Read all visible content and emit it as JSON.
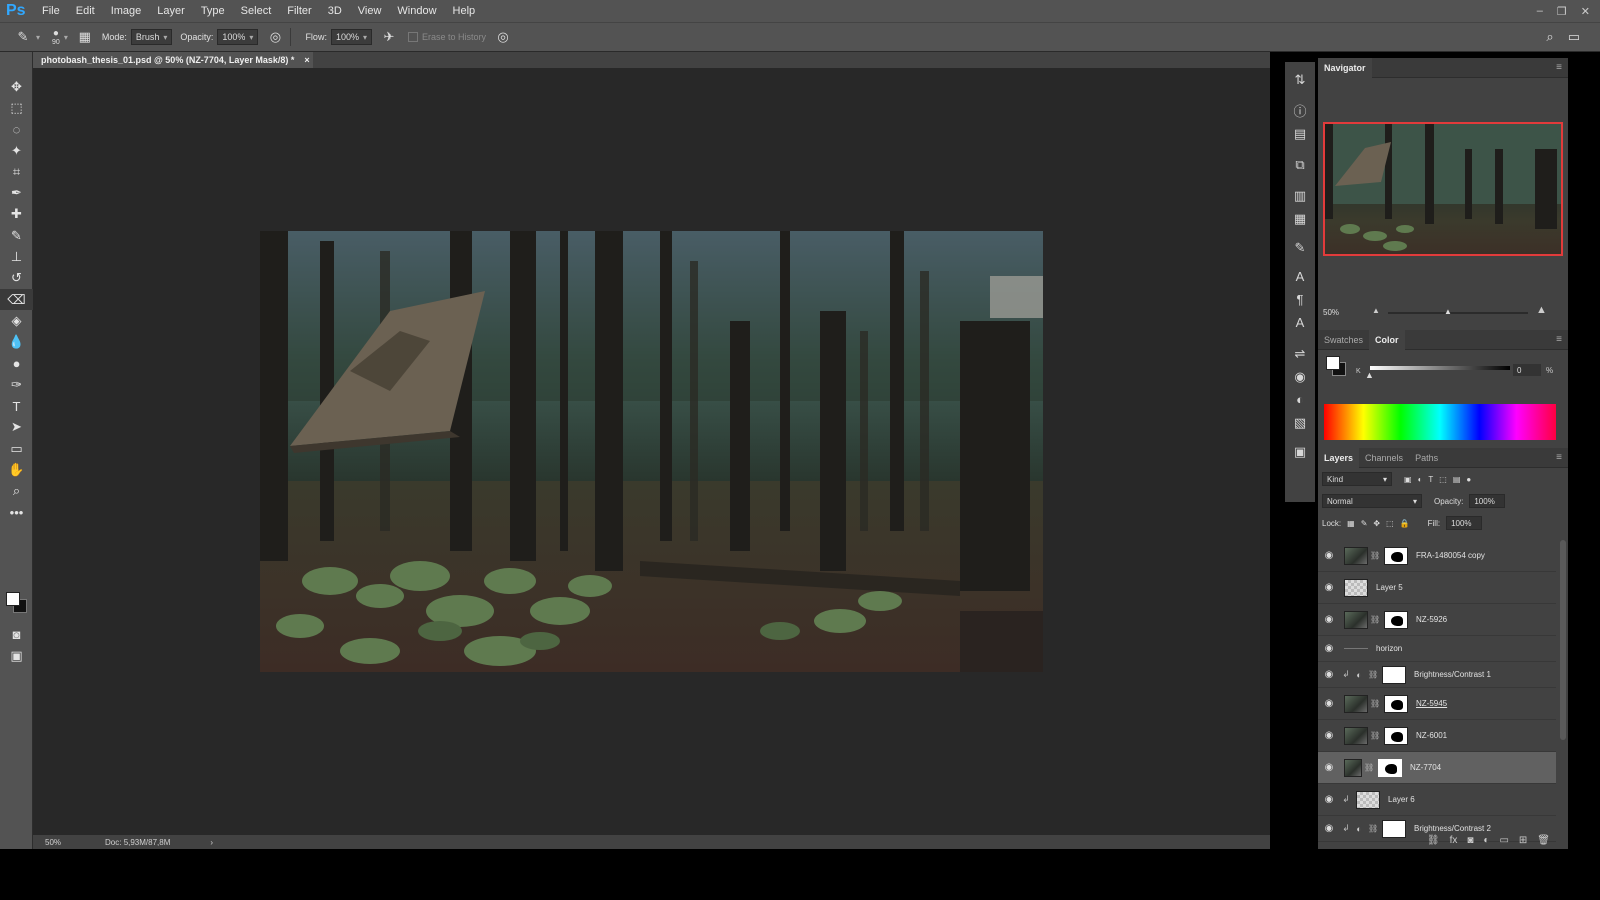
{
  "app": {
    "logo": "Ps"
  },
  "menu": [
    "File",
    "Edit",
    "Image",
    "Layer",
    "Type",
    "Select",
    "Filter",
    "3D",
    "View",
    "Window",
    "Help"
  ],
  "options_bar": {
    "brush_size": "90",
    "mode_label": "Mode:",
    "mode_value": "Brush",
    "opacity_label": "Opacity:",
    "opacity_value": "100%",
    "flow_label": "Flow:",
    "flow_value": "100%",
    "erase_history_label": "Erase to History"
  },
  "document": {
    "tab_title": "photobash_thesis_01.psd @ 50% (NZ-7704, Layer Mask/8) *",
    "close": "×"
  },
  "status": {
    "zoom": "50%",
    "doc_info": "Doc: 5,93M/87,8M",
    "arrow": "›"
  },
  "navigator": {
    "title": "Navigator",
    "zoom": "50%"
  },
  "color_panel": {
    "tabs": [
      "Swatches",
      "Color"
    ],
    "active_tab": "Color",
    "channel_label": "K",
    "k_value": "0",
    "percent": "%"
  },
  "layers_panel": {
    "tabs": [
      "Layers",
      "Channels",
      "Paths"
    ],
    "active_tab": "Layers",
    "kind_filter": "Kind",
    "blend_mode": "Normal",
    "opacity_label": "Opacity:",
    "opacity_value": "100%",
    "lock_label": "Lock:",
    "fill_label": "Fill:",
    "fill_value": "100%",
    "layers": [
      {
        "name": "FRA-1480054 copy",
        "type": "image-mask",
        "selected": false,
        "underline": false
      },
      {
        "name": "Layer 5",
        "type": "transparent",
        "selected": false,
        "underline": false
      },
      {
        "name": "NZ-5926",
        "type": "image-mask",
        "selected": false,
        "underline": false
      },
      {
        "name": "horizon",
        "type": "line",
        "selected": false,
        "underline": false
      },
      {
        "name": "Brightness/Contrast 1",
        "type": "adjustment",
        "selected": false,
        "underline": false
      },
      {
        "name": "NZ-5945",
        "type": "image-mask",
        "selected": false,
        "underline": true
      },
      {
        "name": "NZ-6001",
        "type": "image-mask",
        "selected": false,
        "underline": false
      },
      {
        "name": "NZ-7704",
        "type": "image-mask",
        "selected": true,
        "underline": false
      },
      {
        "name": "Layer 6",
        "type": "transparent-clip",
        "selected": false,
        "underline": false
      },
      {
        "name": "Brightness/Contrast 2",
        "type": "adjustment",
        "selected": false,
        "underline": false
      }
    ]
  },
  "colors": {
    "ui_dark": "#282828",
    "ui_panel": "#424242",
    "ui_bar": "#535353",
    "ps_blue": "#31a8ff",
    "nav_frame": "#e23b3b"
  }
}
